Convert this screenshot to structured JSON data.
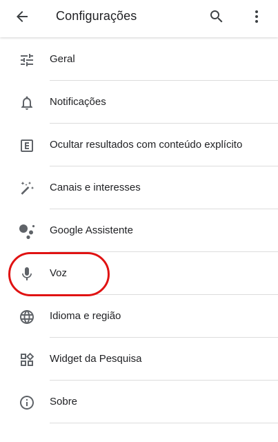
{
  "header": {
    "title": "Configurações",
    "back_icon": "arrow-back-icon",
    "search_icon": "search-icon",
    "more_icon": "more-vert-icon"
  },
  "items": [
    {
      "label": "Geral",
      "icon": "tune-sliders-icon"
    },
    {
      "label": "Notificações",
      "icon": "bell-icon"
    },
    {
      "label": "Ocultar resultados com conteúdo explícito",
      "icon": "explicit-e-icon"
    },
    {
      "label": "Canais e interesses",
      "icon": "magic-wand-icon"
    },
    {
      "label": "Google Assistente",
      "icon": "assistant-dots-icon"
    },
    {
      "label": "Voz",
      "icon": "microphone-icon"
    },
    {
      "label": "Idioma e região",
      "icon": "globe-icon"
    },
    {
      "label": "Widget da Pesquisa",
      "icon": "widget-grid-icon"
    },
    {
      "label": "Sobre",
      "icon": "info-icon"
    }
  ],
  "colors": {
    "text": "#202124",
    "icon": "#5f6368",
    "divider": "#dcdcdc",
    "highlight": "#e01212"
  }
}
